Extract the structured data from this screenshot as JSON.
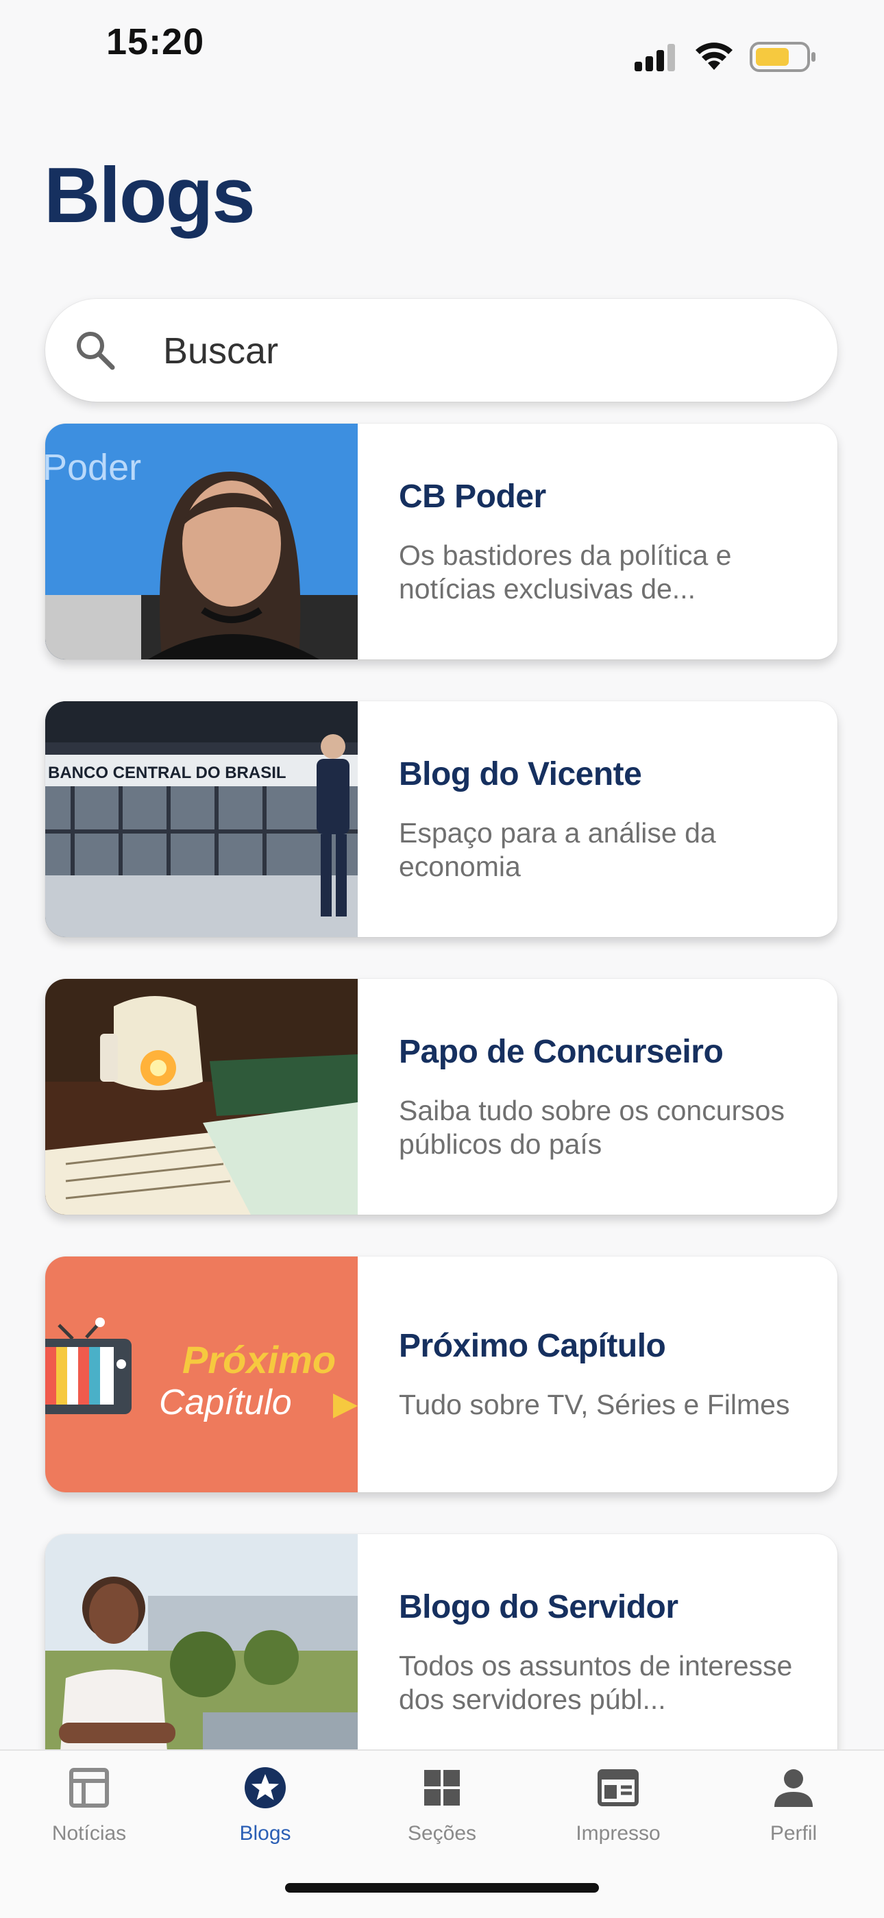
{
  "status_bar": {
    "time": "15:20"
  },
  "page": {
    "title": "Blogs"
  },
  "search": {
    "placeholder": "Buscar"
  },
  "blogs": [
    {
      "title": "CB Poder",
      "description": "Os bastidores da política e notícias exclusivas de...",
      "thumb_text": "Poder"
    },
    {
      "title": "Blog do Vicente",
      "description": "Espaço para a análise da economia",
      "thumb_text": "BANCO CENTRAL DO BRASIL"
    },
    {
      "title": "Papo de Concurseiro",
      "description": "Saiba tudo sobre os concursos públicos do país"
    },
    {
      "title": "Próximo Capítulo",
      "description": "Tudo sobre TV, Séries e Filmes",
      "thumb_text_1": "Próximo",
      "thumb_text_2": "Capítulo"
    },
    {
      "title": "Blogo do Servidor",
      "description": "Todos os assuntos de interesse dos servidores públ..."
    }
  ],
  "tabs": [
    {
      "label": "Notícias",
      "icon": "newspaper-layout-icon"
    },
    {
      "label": "Blogs",
      "icon": "star-badge-icon",
      "active": true
    },
    {
      "label": "Seções",
      "icon": "grid-icon"
    },
    {
      "label": "Impresso",
      "icon": "print-newspaper-icon"
    },
    {
      "label": "Perfil",
      "icon": "person-icon"
    }
  ],
  "colors": {
    "brand": "#16305f",
    "active_tab": "#2b5fb5",
    "inactive_tab": "#8a8a8a",
    "battery": "#f6c93f"
  }
}
